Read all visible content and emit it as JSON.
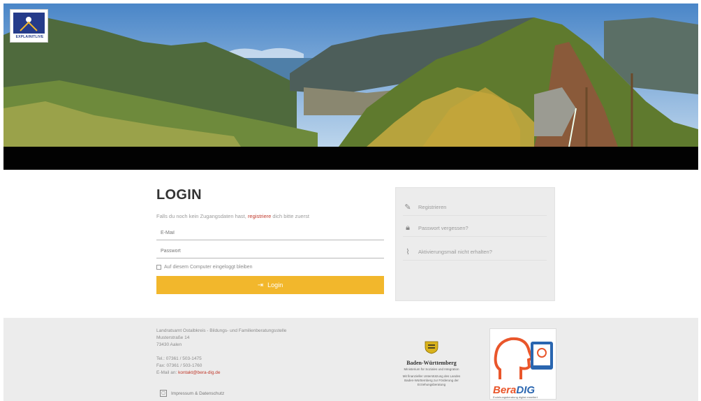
{
  "header": {
    "logo_text": "EXPLAINITLIVE",
    "banner_icon": "mountain-landscape-photo"
  },
  "login": {
    "title": "LOGIN",
    "hint_prefix": "Falls du noch kein Zugangsdaten hast,",
    "hint_link": "registriere",
    "hint_suffix": "dich bitte zuerst",
    "email_placeholder": "E-Mail",
    "password_placeholder": "Passwort",
    "remember_label": "Auf diesem Computer eingeloggt bleiben",
    "button_label": "Login",
    "button_icon": "login-arrow-icon",
    "accent_color": "#f2b72c"
  },
  "side_links": [
    {
      "icon": "pencil-icon",
      "label": "Registrieren"
    },
    {
      "icon": "lock-icon",
      "label": "Passwort vergessen?"
    },
    {
      "icon": "paperclip-icon",
      "label": "Aktivierungsmail nicht erhalten?"
    }
  ],
  "footer": {
    "address_lines": [
      "Landratsamt Ostalbkreis - Bildungs- und Familienberatungsstelle",
      "Musterstraße 14",
      "73430 Aalen"
    ],
    "phone": "Tel.: 07361 / 503-1475",
    "fax": "Fax: 07361 / 503-1760",
    "email_prefix": "E-Mail an:",
    "email_link": "kontakt@bera-dig.de",
    "imprint_label": "Impressum & Datenschutz",
    "bw_name": "Baden-Württemberg",
    "bw_sub1": "Ministerium für Soziales und Integration",
    "bw_sub2": "Mit finanzieller Unterstützung des Landes Baden-Württemberg zur Förderung der Erziehungsberatung",
    "bera_part1": "Bera",
    "bera_part2": "DIG",
    "bera_tag": "Erziehungsberatung digital erweitert"
  }
}
